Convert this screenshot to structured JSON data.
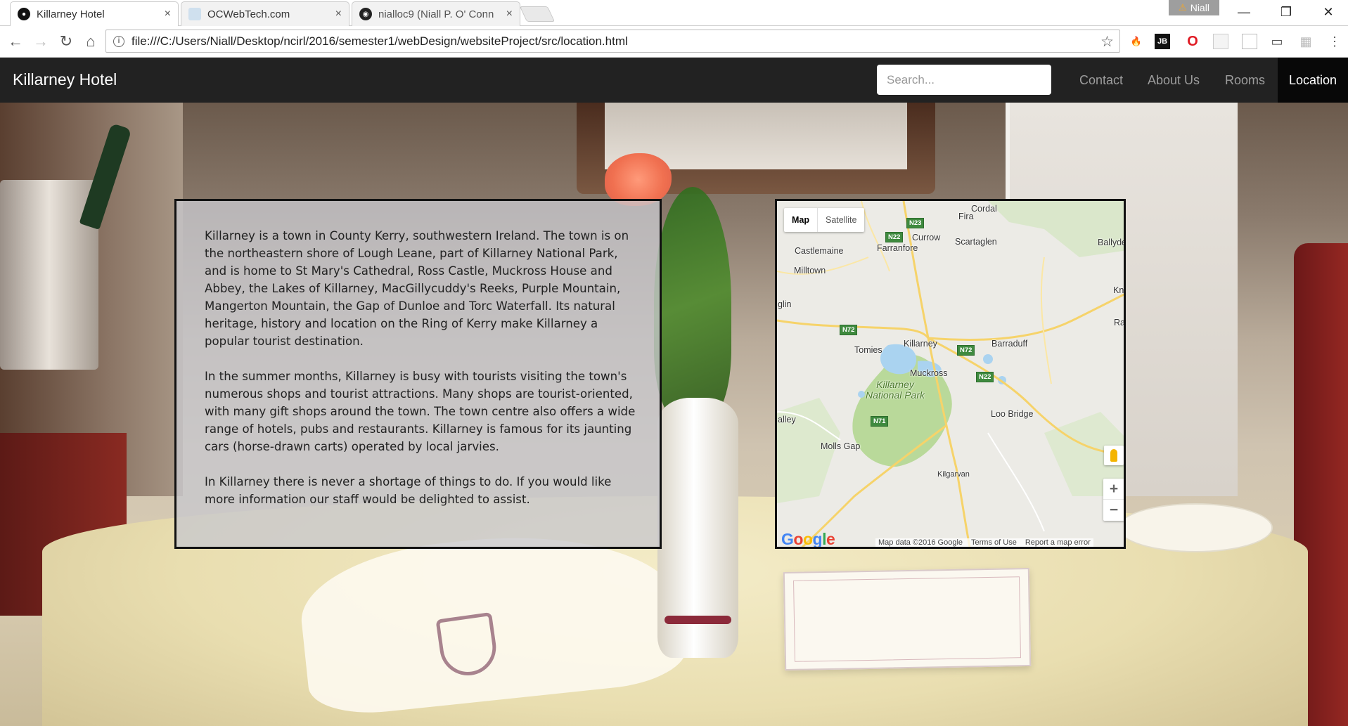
{
  "browser": {
    "tabs": [
      {
        "title": "Killarney Hotel",
        "close": "×",
        "active": true,
        "favicon_color": "#111111"
      },
      {
        "title": "OCWebTech.com",
        "close": "×",
        "active": false,
        "favicon_color": "#cfe0ee"
      },
      {
        "title": "nialloc9 (Niall P. O' Conn",
        "close": "×",
        "active": false,
        "favicon_color": "#222222"
      }
    ],
    "profile_name": "Niall",
    "window_controls": {
      "minimize": "—",
      "restore": "❐",
      "close": "✕"
    },
    "url": "file:///C:/Users/Niall/Desktop/ncirl/2016/semester1/webDesign/websiteProject/src/location.html",
    "nav_icons": [
      "back-icon",
      "forward-icon",
      "reload-icon",
      "home-icon"
    ],
    "extension_icons": [
      "flame-icon",
      "jb-icon",
      "opera-icon",
      "doc-icon",
      "window-icon",
      "cast-icon",
      "grid-icon",
      "menu-icon"
    ]
  },
  "site": {
    "brand": "Killarney Hotel",
    "search_placeholder": "Search...",
    "nav": [
      {
        "label": "Contact",
        "active": false
      },
      {
        "label": "About Us",
        "active": false
      },
      {
        "label": "Rooms",
        "active": false
      },
      {
        "label": "Location",
        "active": true
      }
    ]
  },
  "content": {
    "paragraphs": [
      "Killarney is a town in County Kerry, southwestern Ireland. The town is on the northeastern shore of Lough Leane, part of Killarney National Park, and is home to St Mary's Cathedral, Ross Castle, Muckross House and Abbey, the Lakes of Killarney, MacGillycuddy's Reeks, Purple Mountain, Mangerton Mountain, the Gap of Dunloe and Torc Waterfall. Its natural heritage, history and location on the Ring of Kerry make Killarney a popular tourist destination.",
      "In the summer months, Killarney is busy with tourists visiting the town's numerous shops and tourist attractions. Many shops are tourist-oriented, with many gift shops around the town. The town centre also offers a wide range of hotels, pubs and restaurants. Killarney is famous for its jaunting cars (horse-drawn carts) operated by local jarvies.",
      "In Killarney there is never a shortage of things to do. If you would like more information our staff would be delighted to assist."
    ]
  },
  "map": {
    "type_buttons": [
      "Map",
      "Satellite"
    ],
    "zoom_in": "+",
    "zoom_out": "−",
    "logo": "Google",
    "attribution": [
      "Map data ©2016 Google",
      "Terms of Use",
      "Report a map error"
    ],
    "places": [
      "Cordal",
      "Fira",
      "Currow",
      "Farranfore",
      "Scartaglen",
      "Ballyde",
      "Castlemaine",
      "Milltown",
      "Kn",
      "glin",
      "Ra",
      "Tomies",
      "Killarney",
      "Barraduff",
      "Muckross",
      "Killarney National Park",
      "Loo Bridge",
      "alley",
      "Molls Gap",
      "Kilgarvan"
    ],
    "road_badges": [
      "N23",
      "N22",
      "N72",
      "N72",
      "N22",
      "N71"
    ]
  }
}
